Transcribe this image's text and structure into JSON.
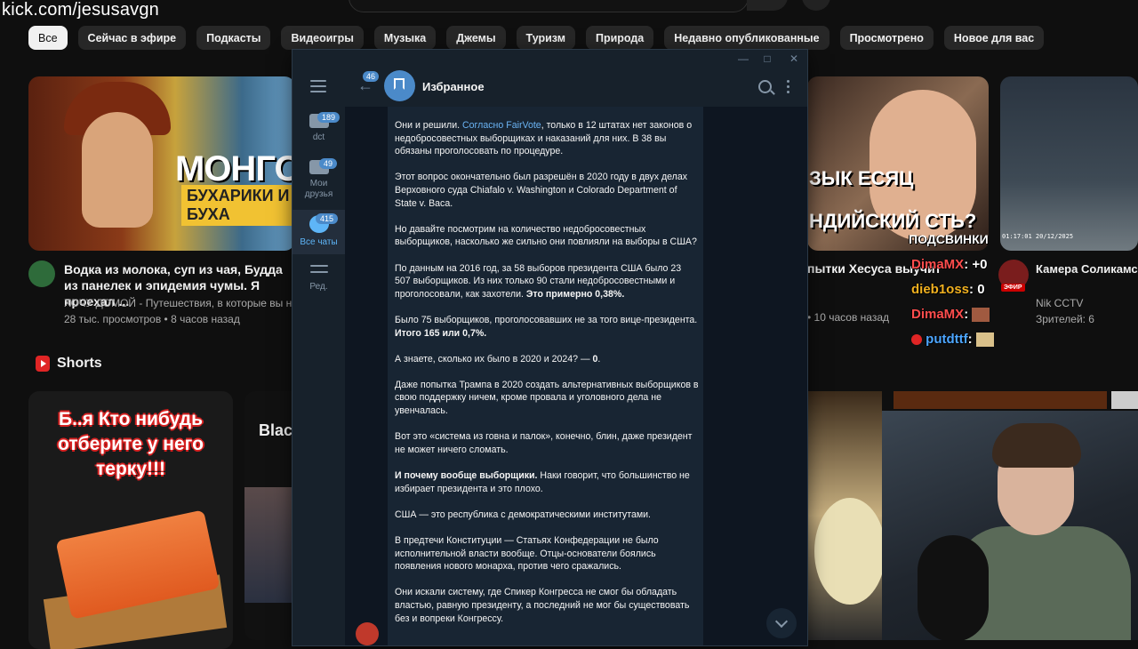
{
  "overlay": {
    "kick_url": "kick.com/jesusavgn"
  },
  "chips": [
    "Все",
    "Сейчас в эфире",
    "Подкасты",
    "Видеоигры",
    "Музыка",
    "Джемы",
    "Туризм",
    "Природа",
    "Недавно опубликованные",
    "Просмотрено",
    "Новое для вас"
  ],
  "videos": [
    {
      "thumb_text_1": "МОНГОЛ",
      "thumb_text_2": "БУХАРИКИ И БУХА",
      "title": "Водка из молока, суп из чая, Будда из панелек и эпидемия чумы. Я проехал ...",
      "channel": "ХОЧУ ДОМОЙ - Путешествия, в которые вы не",
      "meta": "28 тыс. просмотров • 8 часов назад"
    },
    {
      "thumb_text_1": "ЗЫК ЕСЯЦ",
      "thumb_text_2": "НДИЙСКИЙ СТЬ?",
      "title": "пытки Хесуса выучит",
      "meta": "• 10 часов назад"
    },
    {
      "thumb_timestamp": "01:17:01  20/12/2025",
      "live_label": "ЭФИР",
      "title": "Камера Соликамск Пермский край / С",
      "channel": "Nik CCTV",
      "meta": "Зрителей: 6"
    }
  ],
  "stream_chat": {
    "header": "ПОДСВИНКИ",
    "lines": [
      {
        "user": "DimaMX",
        "text": ": +0",
        "color": "#ff4d4d"
      },
      {
        "user": "dieb1oss",
        "text": ": 0",
        "color": "#f0b020"
      },
      {
        "user": "DimaMX",
        "text": ":",
        "color": "#ff4d4d"
      },
      {
        "user": "putdttf",
        "text": ":",
        "color": "#4da6ff"
      }
    ]
  },
  "shorts": {
    "heading": "Shorts",
    "items": [
      {
        "caption": "Б..я Кто нибудь отберите у него терку!!!"
      },
      {
        "caption": "Blac"
      }
    ]
  },
  "telegram": {
    "window_controls": [
      "—",
      "□",
      "✕"
    ],
    "folders": [
      {
        "label": "dct",
        "badge": "189"
      },
      {
        "label": "Мои друзья",
        "badge": "49"
      },
      {
        "label": "Все чаты",
        "badge": "415",
        "active": true
      },
      {
        "label": "Ред."
      }
    ],
    "back_badge": "46",
    "chat_title": "Избранное",
    "message": {
      "p1_a": "Они и решили. ",
      "p1_link": "Согласно FairVote",
      "p1_b": ", только в 12 штатах нет законов о недобросовестных выборщиках и наказаний для них. В 38 вы обязаны проголосовать по процедуре.",
      "p2": "Этот вопрос окончательно был разрешён в 2020 году в двух делах Верховного суда Chiafalo v. Washington и Colorado Department of State v. Baca.",
      "p3": "Но давайте посмотрим на количество недобросовестных выборщиков, насколько же сильно они повлияли на выборы в США?",
      "p4_a": "По данным на 2016 год, за 58 выборов президента США было 23 507 выборщиков. Из них только 90 стали недобросовестными и проголосовали, как захотели. ",
      "p4_b": "Это примерно 0,38%.",
      "p5_a": "Было 75 выборщиков, проголосовавших не за того вице-президента. ",
      "p5_b": "Итого 165 или 0,7%.",
      "p6_a": "А знаете, сколько их было в 2020 и 2024? — ",
      "p6_b": "0",
      "p6_c": ".",
      "p7": "Даже попытка Трампа в 2020 создать альтернативных выборщиков в свою поддержку ничем, кроме провала и уголовного дела не увенчалась.",
      "p8": "Вот это «система из говна и палок», конечно, блин, даже президент не может ничего сломать.",
      "p9_a": "И почему вообще выборщики.",
      "p9_b": " Наки говорит, что большинство не избирает президента и это плохо.",
      "p10": "США — это республика с демократическими институтами.",
      "p11": "В предтечи Конституции — Статьях Конфедерации не было исполнительной власти вообще. Отцы-основатели боялись появления нового монарха, против чего сражались.",
      "p12": "Они искали систему, где Спикер Конгресса не смог бы обладать властью, равную президенту, а последний не мог бы существовать без и вопреки Конгрессу."
    }
  }
}
